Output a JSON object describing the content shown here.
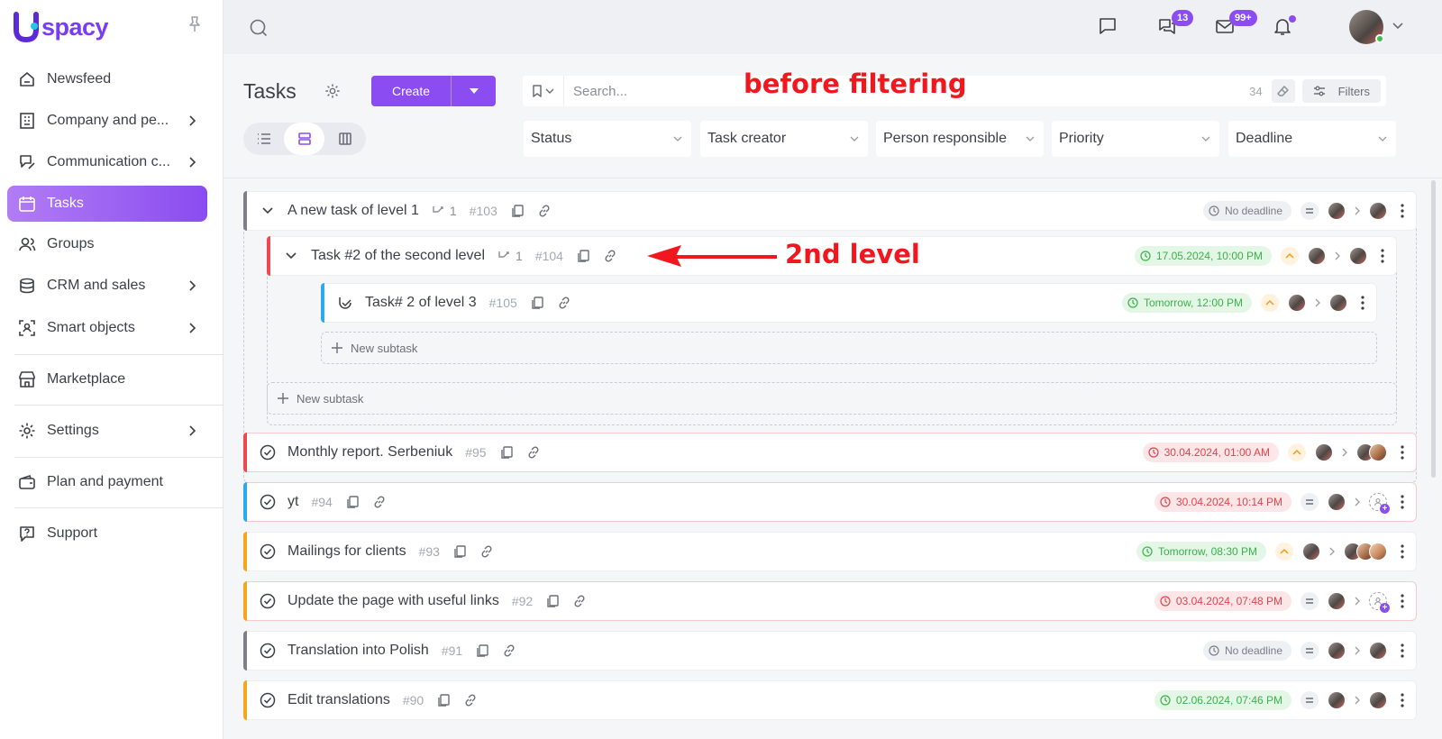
{
  "app": {
    "logo_letter": "U",
    "logo_text": "spacy"
  },
  "sidebar": {
    "items": [
      {
        "label": "Newsfeed",
        "icon": "home-icon"
      },
      {
        "label": "Company and pe...",
        "icon": "building-icon",
        "has_chevron": true
      },
      {
        "label": "Communication c...",
        "icon": "chat-edit-icon",
        "has_chevron": true
      },
      {
        "label": "Tasks",
        "icon": "calendar-icon",
        "active": true
      },
      {
        "label": "Groups",
        "icon": "users-icon"
      },
      {
        "label": "CRM and sales",
        "icon": "database-icon",
        "has_chevron": true
      },
      {
        "label": "Smart objects",
        "icon": "scan-user-icon",
        "has_chevron": true
      },
      {
        "label": "Marketplace",
        "icon": "store-icon"
      },
      {
        "label": "Settings",
        "icon": "gear-icon",
        "has_chevron": true
      },
      {
        "label": "Plan and payment",
        "icon": "wallet-icon"
      },
      {
        "label": "Support",
        "icon": "help-icon"
      }
    ]
  },
  "topbar": {
    "chat_badge": "13",
    "mail_badge": "99+"
  },
  "header": {
    "title": "Tasks",
    "create_label": "Create",
    "search_placeholder": "Search...",
    "count": "34",
    "filters_label": "Filters",
    "filters": [
      "Status",
      "Task creator",
      "Person responsible",
      "Priority",
      "Deadline"
    ]
  },
  "annotations": {
    "before": "before filtering",
    "level": "2nd level"
  },
  "tasks": {
    "t103": {
      "title": "A new task of level 1",
      "sub": "1",
      "id": "#103",
      "deadline": "No deadline"
    },
    "t104": {
      "title": "Task #2 of the second level",
      "sub": "1",
      "id": "#104",
      "deadline": "17.05.2024, 10:00 PM"
    },
    "t105": {
      "title": "Task# 2 of level 3",
      "id": "#105",
      "deadline": "Tomorrow, 12:00 PM"
    },
    "new_subtask": "New subtask",
    "list": [
      {
        "title": "Monthly report. Serbeniuk",
        "id": "#95",
        "deadline": "30.04.2024, 01:00 AM"
      },
      {
        "title": "yt",
        "id": "#94",
        "deadline": "30.04.2024, 10:14 PM"
      },
      {
        "title": "Mailings for clients",
        "id": "#93",
        "deadline": "Tomorrow, 08:30 PM"
      },
      {
        "title": "Update the page with useful links",
        "id": "#92",
        "deadline": "03.04.2024, 07:48 PM"
      },
      {
        "title": "Translation into Polish",
        "id": "#91",
        "deadline": "No deadline"
      },
      {
        "title": "Edit translations",
        "id": "#90",
        "deadline": "02.06.2024, 07:46 PM"
      }
    ]
  },
  "colors": {
    "accent": "#8b4df2",
    "stripe_gray": "#7d8089",
    "stripe_red": "#ef4850",
    "stripe_blue": "#2fa9ee",
    "stripe_orange": "#f7a51c",
    "annotation": "#f0171f"
  }
}
